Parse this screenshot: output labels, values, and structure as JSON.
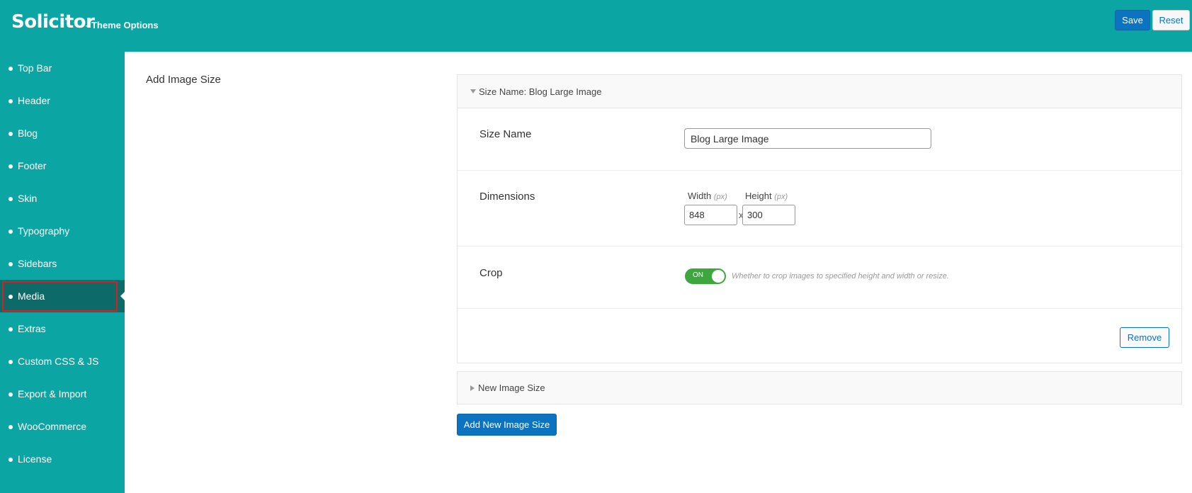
{
  "header": {
    "brand": "Solicitor",
    "subtitle": "- Theme Options",
    "save_label": "Save",
    "reset_label": "Reset"
  },
  "sidebar": {
    "items": [
      {
        "label": "Top Bar"
      },
      {
        "label": "Header"
      },
      {
        "label": "Blog"
      },
      {
        "label": "Footer"
      },
      {
        "label": "Skin"
      },
      {
        "label": "Typography"
      },
      {
        "label": "Sidebars"
      },
      {
        "label": "Media"
      },
      {
        "label": "Extras"
      },
      {
        "label": "Custom CSS & JS"
      },
      {
        "label": "Export & Import"
      },
      {
        "label": "WooCommerce"
      },
      {
        "label": "License"
      }
    ],
    "active": "Media"
  },
  "main": {
    "section_title": "Add Image Size",
    "group": {
      "heading": "Size Name: Blog Large Image",
      "size_name_label": "Size Name",
      "size_name_value": "Blog Large Image",
      "dimensions_label": "Dimensions",
      "width_label": "Width",
      "height_label": "Height",
      "unit": "(px)",
      "width_value": "848",
      "height_value": "300",
      "separator": "x",
      "crop_label": "Crop",
      "crop_toggle": "ON",
      "crop_hint": "Whether to crop images to specified height and width or resize.",
      "remove_label": "Remove"
    },
    "collapsed_group": {
      "heading": "New Image Size"
    },
    "add_button": "Add New Image Size"
  },
  "colors": {
    "brand": "#0ba6a3",
    "active_sidebar": "#0c6a69",
    "primary_button": "#0b73c0",
    "toggle_on": "#3ea63e",
    "highlight_outline": "#d7201f"
  }
}
